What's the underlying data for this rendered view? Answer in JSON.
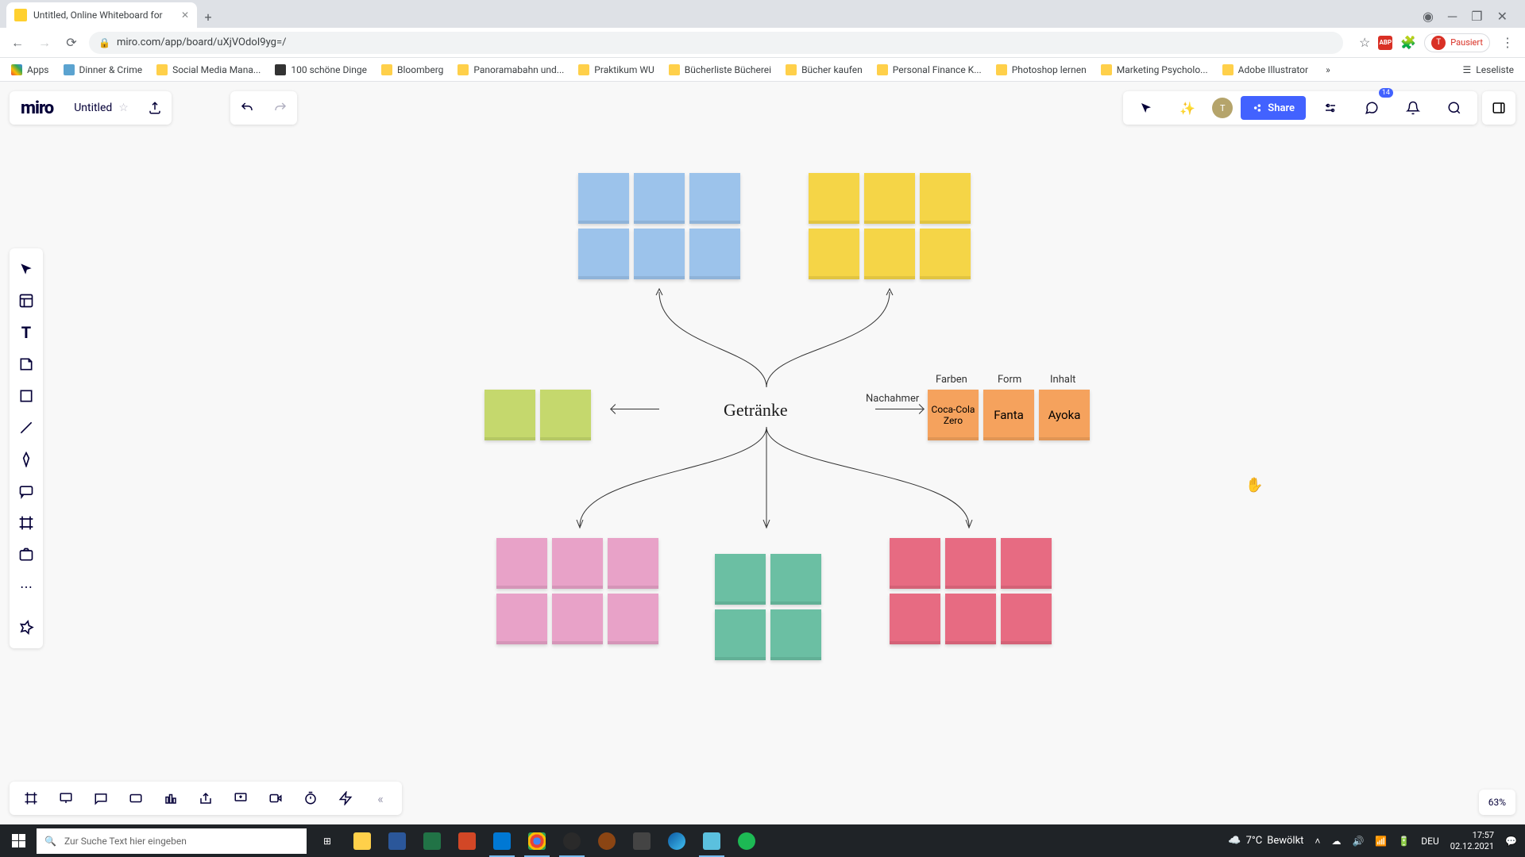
{
  "browser": {
    "tab_title": "Untitled, Online Whiteboard for",
    "url": "miro.com/app/board/uXjVOdoI9yg=/",
    "profile_status": "Pausiert",
    "bookmarks": [
      {
        "label": "Apps",
        "type": "apps"
      },
      {
        "label": "Dinner & Crime",
        "type": "site"
      },
      {
        "label": "Social Media Mana...",
        "type": "folder"
      },
      {
        "label": "100 schöne Dinge",
        "type": "site"
      },
      {
        "label": "Bloomberg",
        "type": "folder"
      },
      {
        "label": "Panoramabahn und...",
        "type": "folder"
      },
      {
        "label": "Praktikum WU",
        "type": "folder"
      },
      {
        "label": "Bücherliste Bücherei",
        "type": "folder"
      },
      {
        "label": "Bücher kaufen",
        "type": "folder"
      },
      {
        "label": "Personal Finance K...",
        "type": "folder"
      },
      {
        "label": "Photoshop lernen",
        "type": "folder"
      },
      {
        "label": "Marketing Psycholo...",
        "type": "folder"
      },
      {
        "label": "Adobe Illustrator",
        "type": "folder"
      }
    ],
    "leseliste": "Leseliste"
  },
  "miro": {
    "logo": "miro",
    "board_name": "Untitled",
    "share": "Share",
    "notif_count": "14",
    "zoom": "63%",
    "user_initial": "T"
  },
  "canvas": {
    "center": "Getränke",
    "left_arrow_label": "Nachahmer",
    "col_labels": [
      "Farben",
      "Form",
      "Inhalt"
    ],
    "orange_notes": [
      "Coca-Cola Zero",
      "Fanta",
      "Ayoka"
    ]
  },
  "taskbar": {
    "search_placeholder": "Zur Suche Text hier eingeben",
    "weather_temp": "7°C",
    "weather_text": "Bewölkt",
    "lang": "DEU",
    "time": "17:57",
    "date": "02.12.2021"
  }
}
